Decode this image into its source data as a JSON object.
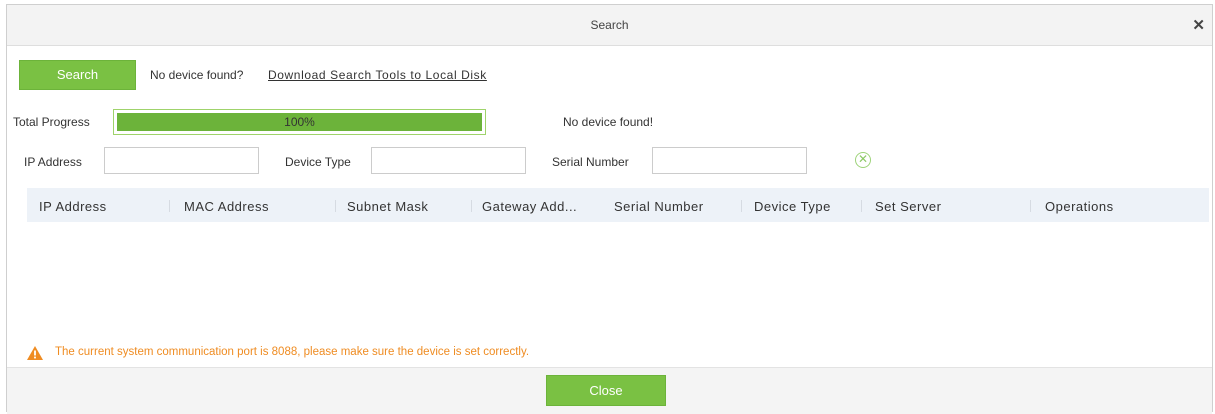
{
  "dialog": {
    "title": "Search",
    "close_glyph": "✕",
    "close_icon": "close-icon"
  },
  "toolbar": {
    "search_label": "Search",
    "no_device_prompt": "No device found?",
    "download_link": "Download Search Tools to Local Disk"
  },
  "progress": {
    "label": "Total Progress",
    "percent": 100,
    "text": "100%",
    "status": "No device found!"
  },
  "filters": {
    "ip_label": "IP Address",
    "ip_value": "",
    "device_type_label": "Device Type",
    "device_type_value": "",
    "serial_label": "Serial Number",
    "serial_value": "",
    "clear_glyph": "✕",
    "clear_icon": "clear-filter-icon"
  },
  "table": {
    "columns": [
      "IP Address",
      "MAC Address",
      "Subnet Mask",
      "Gateway Add...",
      "Serial Number",
      "Device Type",
      "Set Server",
      "Operations"
    ],
    "rows": []
  },
  "notice": {
    "icon": "warning-icon",
    "text": "The current system communication port is 8088, please make sure the device is set correctly."
  },
  "footer": {
    "close_label": "Close"
  },
  "colors": {
    "accent_green": "#7ac143",
    "progress_green": "#6cb33a",
    "warning_orange": "#ef8c22",
    "header_bg": "#edf2f8"
  }
}
